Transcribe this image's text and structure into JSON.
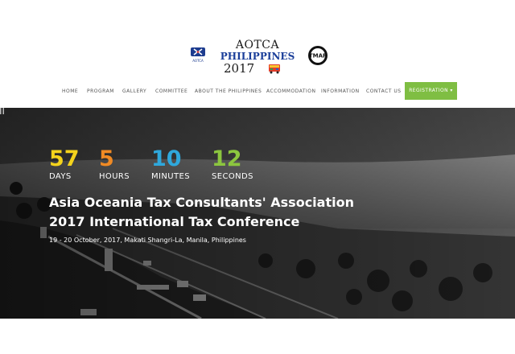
{
  "header": {
    "brand_line1": "AOTCA",
    "brand_line2": "PHILIPPINES",
    "brand_line3": "2017",
    "left_logo_text": "AOTCA",
    "right_logo_text": "TMAP"
  },
  "nav": {
    "items": [
      "HOME",
      "PROGRAM",
      "GALLERY",
      "COMMITTEE",
      "ABOUT THE PHILIPPINES",
      "ACCOMMODATION",
      "INFORMATION",
      "CONTACT US"
    ],
    "registration": "REGISTRATION ▾"
  },
  "colors": {
    "accent_green": "#7fbe43",
    "days": "#f4d31c",
    "hours": "#f08a24",
    "minutes": "#2fa8dc",
    "seconds": "#8cc63f"
  },
  "countdown": {
    "days": {
      "value": "57",
      "label": "DAYS"
    },
    "hours": {
      "value": "5",
      "label": "HOURS"
    },
    "minutes": {
      "value": "10",
      "label": "MINUTES"
    },
    "seconds": {
      "value": "12",
      "label": "SECONDS"
    }
  },
  "hero": {
    "title_line1": "Asia Oceania Tax Consultants' Association",
    "title_line2": "2017 International Tax Conference",
    "subtitle": "19 - 20 October, 2017, Makati Shangri-La, Manila, Philippines"
  }
}
